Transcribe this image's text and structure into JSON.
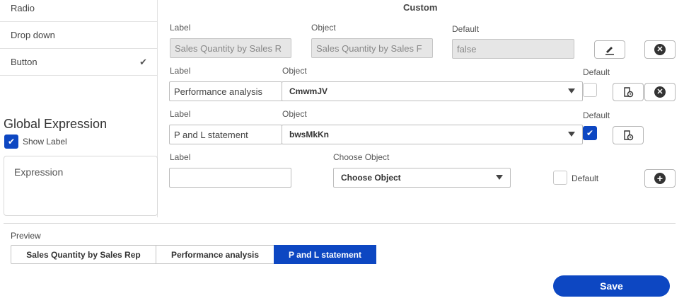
{
  "sidebar": {
    "items": [
      {
        "label": "Radio"
      },
      {
        "label": "Drop down"
      },
      {
        "label": "Button",
        "checked": true
      }
    ],
    "check_mark": "✔",
    "global_expression": {
      "title": "Global Expression",
      "show_label": "Show Label",
      "show_label_checked": true,
      "expression_placeholder": "Expression"
    }
  },
  "custom": {
    "heading": "Custom",
    "rows": [
      {
        "label_caption": "Label",
        "label_value": "Sales Quantity by Sales R",
        "object_caption": "Object",
        "object_value": "Sales Quantity by Sales F",
        "default_caption": "Default",
        "default_value": "false"
      },
      {
        "label_caption": "Label",
        "label_value": "Performance analysis",
        "object_caption": "Object",
        "object_value": "CmwmJV",
        "default_caption": "Default",
        "default_checked": false
      },
      {
        "label_caption": "Label",
        "label_value": "P and L statement",
        "object_caption": "Object",
        "object_value": "bwsMkKn",
        "default_caption": "Default",
        "default_checked": true
      }
    ],
    "new_row": {
      "label_caption": "Label",
      "label_value": "",
      "object_caption": "Choose Object",
      "object_value": "Choose Object",
      "default_caption": "Default"
    }
  },
  "preview": {
    "label": "Preview",
    "tabs": [
      {
        "label": "Sales Quantity by Sales Rep"
      },
      {
        "label": "Performance analysis"
      },
      {
        "label": "P and L statement",
        "active": true
      }
    ]
  },
  "save_label": "Save",
  "colors": {
    "accent": "#0d47c2"
  }
}
